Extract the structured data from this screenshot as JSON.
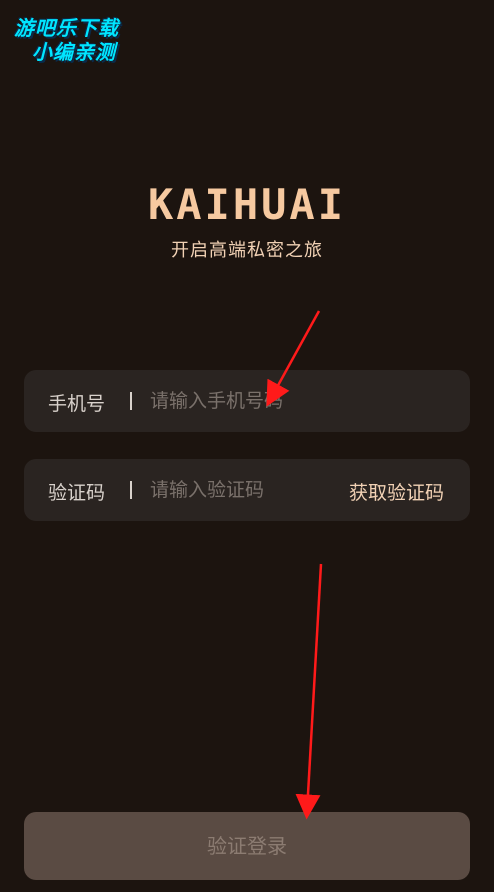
{
  "watermark": {
    "line1": "游吧乐下载",
    "line2": "小编亲测"
  },
  "brand": {
    "name": "KAIHUAI",
    "tagline": "开启高端私密之旅"
  },
  "form": {
    "phone": {
      "label": "手机号",
      "placeholder": "请输入手机号码",
      "value": ""
    },
    "code": {
      "label": "验证码",
      "placeholder": "请输入验证码",
      "value": "",
      "get_code_label": "获取验证码"
    },
    "submit_label": "验证登录"
  },
  "colors": {
    "background": "#1c140f",
    "field_background": "#2a2421",
    "accent": "#f6c9a0",
    "button_disabled": "#5a4b43",
    "annotation_arrow": "#ff1a1a"
  }
}
